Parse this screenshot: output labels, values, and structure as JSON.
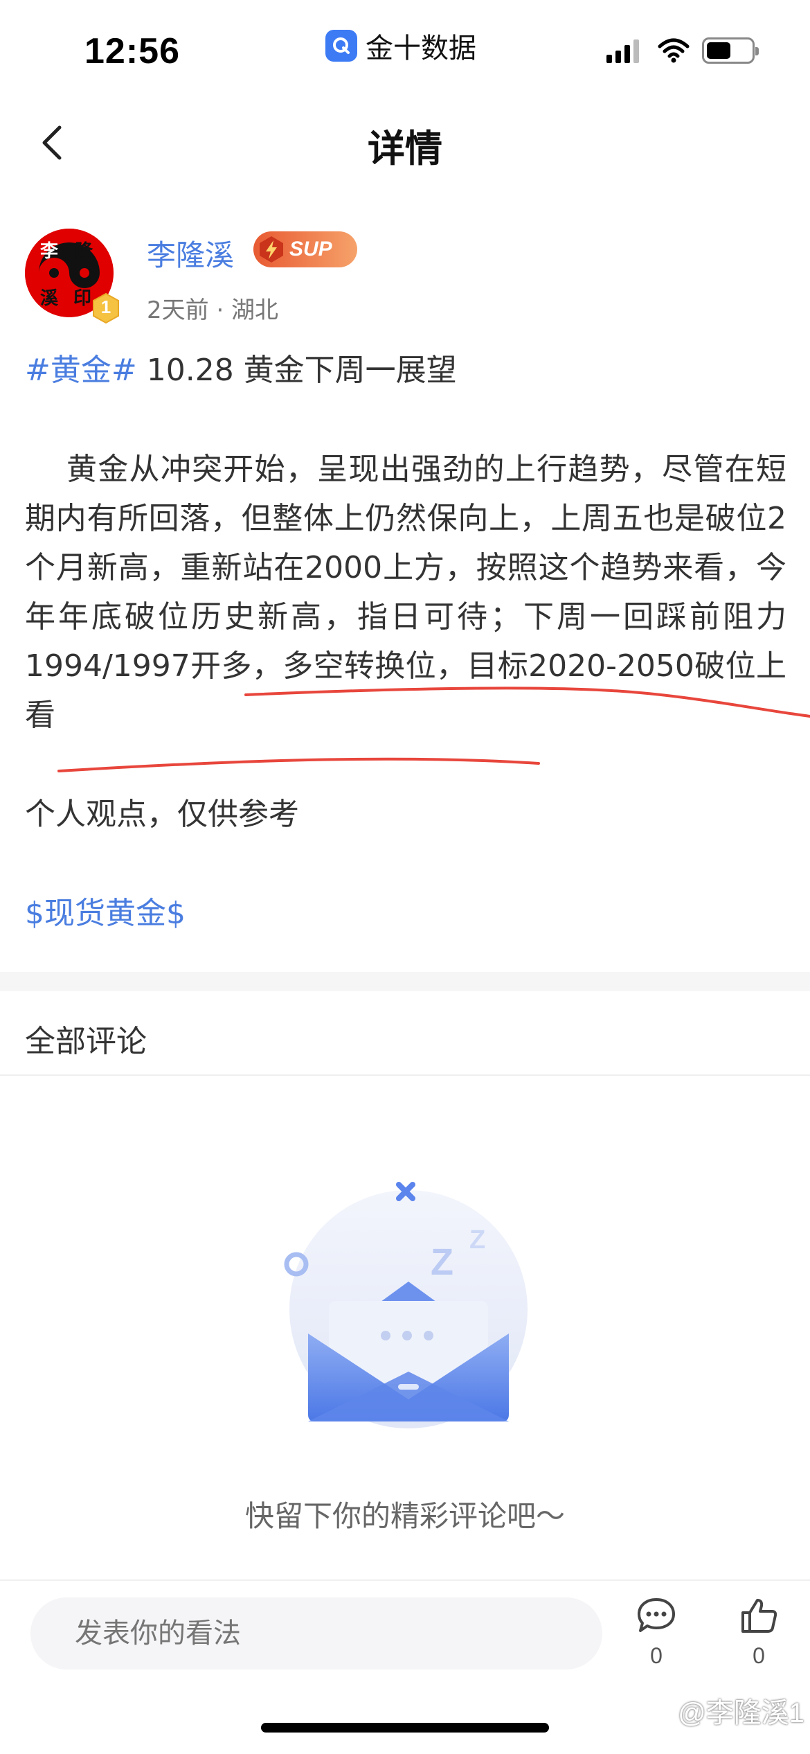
{
  "status_bar": {
    "time": "12:56",
    "app_name": "金十数据"
  },
  "nav": {
    "title": "详情"
  },
  "author": {
    "name": "李隆溪",
    "badge": "SUP",
    "meta": "2天前 · 湖北",
    "level": "1",
    "avatar_text": [
      "李",
      "隆",
      "溪",
      "印"
    ]
  },
  "post": {
    "topic": "#黄金#",
    "title": " 10.28 黄金下周一展望",
    "body": "黄金从冲突开始，呈现出强劲的上行趋势，尽管在短期内有所回落，但整体上仍然保向上，上周五也是破位2个月新高，重新站在2000上方，按照这个趋势来看，今年年底破位历史新高，指日可待；下周一回踩前阻力1994/1997开多，多空转换位，目标2020-2050破位上看",
    "note": "个人观点，仅供参考",
    "tag": "$现货黄金$"
  },
  "comments": {
    "title": "全部评论",
    "empty_text": "快留下你的精彩评论吧～"
  },
  "bottom_bar": {
    "input_placeholder": "发表你的看法",
    "comment_count": "0",
    "like_count": "0"
  },
  "watermark": "@李隆溪1",
  "colors": {
    "accent": "#4a7de0",
    "annotation": "#e8463c",
    "sup_badge": "#e85a32"
  }
}
